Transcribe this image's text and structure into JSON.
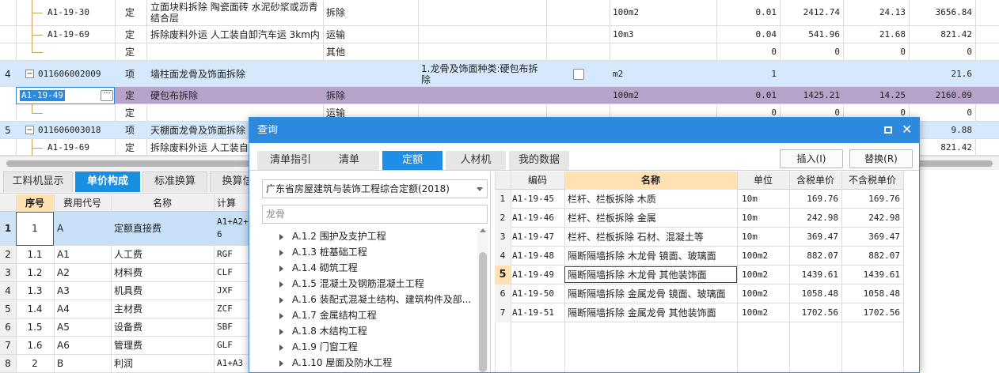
{
  "colors": {
    "accent": "#2d89de",
    "selected_row": "#d6e8fb",
    "purple_row": "#b7a2c9",
    "header_orange": "#ffe1b3"
  },
  "top_rows": [
    {
      "seq": "",
      "code": "A1-19-30",
      "type": "定",
      "name": "立面块料拆除 陶瓷面砖 水泥砂浆或沥青结合层",
      "name2": "",
      "feature": "拆除",
      "desc": "",
      "unit": "100m2",
      "qty": "0.01",
      "price": "2412.74",
      "total": "24.13",
      "extra": "3656.84"
    },
    {
      "seq": "",
      "code": "A1-19-69",
      "type": "定",
      "name": "拆除废料外运 人工装自卸汽车运 3km内",
      "feature": "运输",
      "desc": "",
      "unit": "10m3",
      "qty": "0.04",
      "price": "541.96",
      "total": "21.68",
      "extra": "821.42"
    },
    {
      "seq": "",
      "code": "",
      "type": "定",
      "name": "",
      "feature": "其他",
      "desc": "",
      "unit": "",
      "qty": "0",
      "price": "0",
      "total": "0",
      "extra": "0"
    },
    {
      "seq": "4",
      "code": "011606002009",
      "type": "项",
      "name": "墙柱面龙骨及饰面拆除",
      "feature": "",
      "desc": "1.龙骨及饰面种类:硬包布拆除",
      "unit": "m2",
      "qty": "1",
      "price": "",
      "total": "",
      "extra": "21.6"
    },
    {
      "seq": "",
      "code": "A1-19-49",
      "type": "定",
      "name": "硬包布拆除",
      "feature": "拆除",
      "desc": "",
      "unit": "100m2",
      "qty": "0.01",
      "price": "1425.21",
      "total": "14.25",
      "extra": "2160.09"
    },
    {
      "seq": "",
      "code": "",
      "type": "定",
      "name": "",
      "feature": "运输",
      "desc": "",
      "unit": "",
      "qty": "0",
      "price": "0",
      "total": "0",
      "extra": "0"
    },
    {
      "seq": "5",
      "code": "011606003018",
      "type": "项",
      "name": "天棚面龙骨及饰面拆除",
      "feature": "",
      "desc": "",
      "unit": "",
      "qty": "",
      "price": "",
      "total": "",
      "extra": "9.88"
    },
    {
      "seq": "",
      "code": "A1-19-69",
      "type": "定",
      "name": "拆除废料外运 人工装自",
      "feature": "",
      "desc": "",
      "unit": "",
      "qty": "",
      "price": "",
      "total": "",
      "extra": "821.42"
    }
  ],
  "bottom_tabs": [
    "工料机显示",
    "单价构成",
    "标准换算",
    "换算信"
  ],
  "bottom_headers": [
    "序号",
    "费用代号",
    "名称",
    "计算"
  ],
  "bottom_rows": [
    {
      "no": "1",
      "code": "A",
      "name": "定额直接费",
      "calc": "A1+A2+A",
      "calc2": "6"
    },
    {
      "no": "1.1",
      "code": "A1",
      "name": "人工费",
      "calc": "RGF"
    },
    {
      "no": "1.2",
      "code": "A2",
      "name": "材料费",
      "calc": "CLF"
    },
    {
      "no": "1.3",
      "code": "A3",
      "name": "机具费",
      "calc": "JXF"
    },
    {
      "no": "1.4",
      "code": "A4",
      "name": "主材费",
      "calc": "ZCF"
    },
    {
      "no": "1.5",
      "code": "A5",
      "name": "设备费",
      "calc": "SBF"
    },
    {
      "no": "1.6",
      "code": "A6",
      "name": "管理费",
      "calc": "GLF"
    },
    {
      "no": "2",
      "code": "B",
      "name": "利润",
      "calc": "A1+A3"
    }
  ],
  "bottom_row_labels": [
    "1",
    "2",
    "3",
    "4",
    "5",
    "6",
    "7",
    "8"
  ],
  "dialog": {
    "title": "查询",
    "tabs": [
      "清单指引",
      "清单",
      "定额",
      "人材机",
      "我的数据"
    ],
    "insert_label": "插入(I)",
    "replace_label": "替换(R)",
    "quota_set": "广东省房屋建筑与装饰工程综合定额(2018)",
    "search_value": "龙骨",
    "tree": [
      "A.1.2 围护及支护工程",
      "A.1.3 桩基础工程",
      "A.1.4 砌筑工程",
      "A.1.5 混凝土及钢筋混凝土工程",
      "A.1.6 装配式混凝土结构、建筑构件及部...",
      "A.1.7 金属结构工程",
      "A.1.8 木结构工程",
      "A.1.9 门窗工程",
      "A.1.10 屋面及防水工程"
    ],
    "headers": [
      "编码",
      "名称",
      "单位",
      "含税单价",
      "不含税单价"
    ],
    "rows": [
      {
        "n": "1",
        "code": "A1-19-45",
        "name": "栏杆、栏板拆除 木质",
        "unit": "10m",
        "tax": "169.76",
        "notax": "169.76"
      },
      {
        "n": "2",
        "code": "A1-19-46",
        "name": "栏杆、栏板拆除 金属",
        "unit": "10m",
        "tax": "242.98",
        "notax": "242.98"
      },
      {
        "n": "3",
        "code": "A1-19-47",
        "name": "栏杆、栏板拆除 石材、混凝土等",
        "unit": "10m",
        "tax": "369.47",
        "notax": "369.47"
      },
      {
        "n": "4",
        "code": "A1-19-48",
        "name": "隔断隔墙拆除 木龙骨 镜面、玻璃面",
        "unit": "100m2",
        "tax": "882.07",
        "notax": "882.07"
      },
      {
        "n": "5",
        "code": "A1-19-49",
        "name": "隔断隔墙拆除 木龙骨 其他装饰面",
        "unit": "100m2",
        "tax": "1439.61",
        "notax": "1439.61"
      },
      {
        "n": "6",
        "code": "A1-19-50",
        "name": "隔断隔墙拆除 金属龙骨 镜面、玻璃面",
        "unit": "100m2",
        "tax": "1058.48",
        "notax": "1058.48"
      },
      {
        "n": "7",
        "code": "A1-19-51",
        "name": "隔断隔墙拆除 金属龙骨 其他装饰面",
        "unit": "100m2",
        "tax": "1702.56",
        "notax": "1702.56"
      }
    ]
  }
}
